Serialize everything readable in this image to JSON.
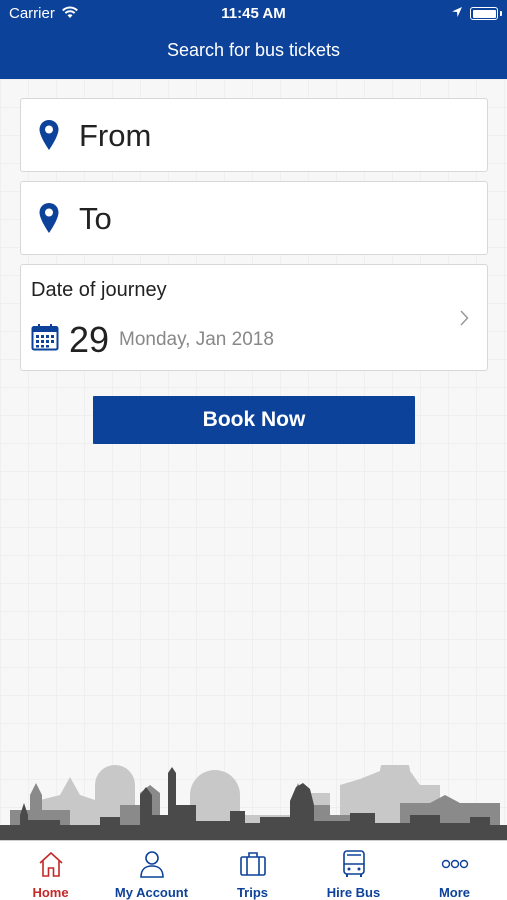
{
  "status_bar": {
    "carrier": "Carrier",
    "time": "11:45 AM"
  },
  "header": {
    "title": "Search for bus tickets"
  },
  "search": {
    "from_label": "From",
    "to_label": "To",
    "date_label": "Date of journey",
    "date_day": "29",
    "date_text": "Monday, Jan 2018"
  },
  "book_button": {
    "label": "Book Now"
  },
  "tabs": [
    {
      "label": "Home",
      "icon": "home-icon",
      "active": true
    },
    {
      "label": "My Account",
      "icon": "user-icon",
      "active": false
    },
    {
      "label": "Trips",
      "icon": "suitcase-icon",
      "active": false
    },
    {
      "label": "Hire Bus",
      "icon": "bus-icon",
      "active": false
    },
    {
      "label": "More",
      "icon": "more-icon",
      "active": false
    }
  ],
  "colors": {
    "brand": "#0c4299",
    "active_tab": "#c62828"
  }
}
